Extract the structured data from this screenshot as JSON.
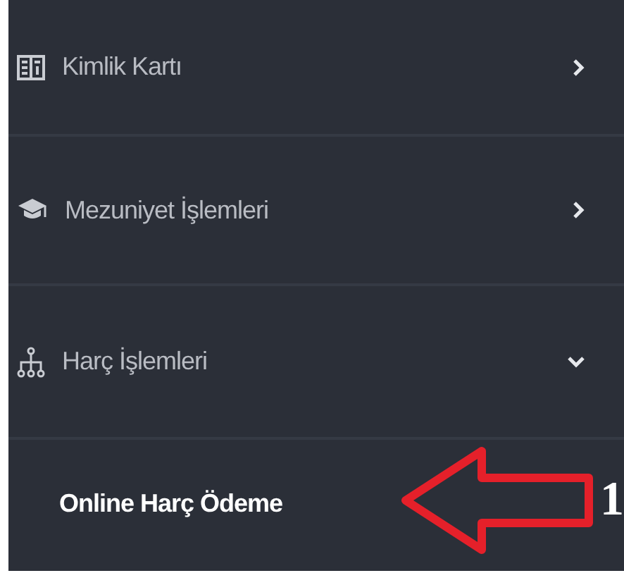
{
  "menu": [
    {
      "label": "Kimlik Kartı",
      "expanded": false
    },
    {
      "label": "Mezuniyet İşlemleri",
      "expanded": false
    },
    {
      "label": "Harç İşlemleri",
      "expanded": true,
      "children": [
        {
          "label": "Online Harç Ödeme",
          "selected": true
        }
      ]
    }
  ],
  "annotation": {
    "label": "1"
  }
}
